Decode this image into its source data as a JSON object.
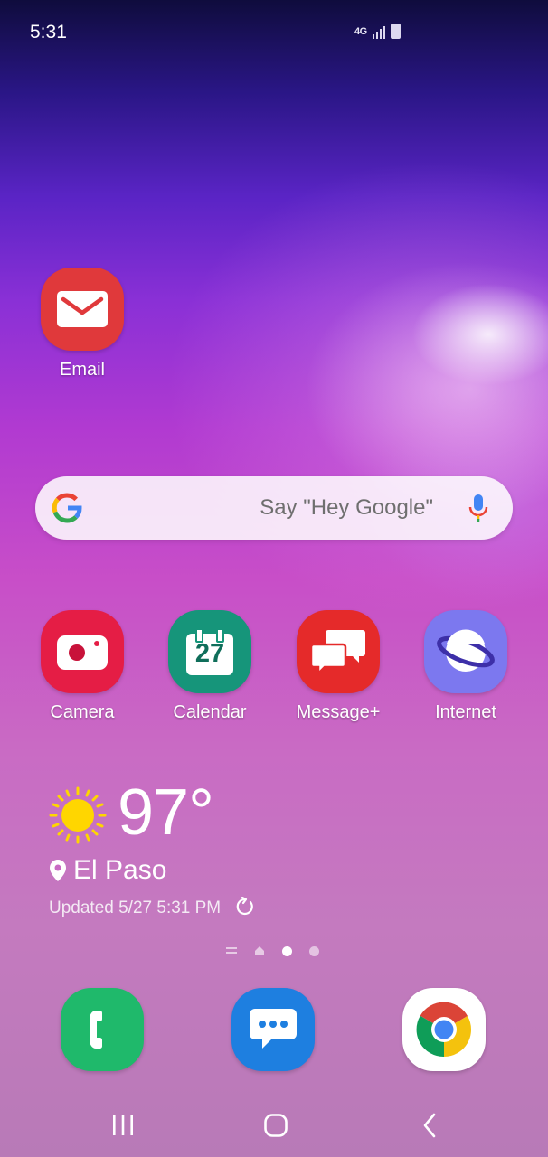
{
  "status_bar": {
    "time": "5:31",
    "network": "4G",
    "icons": [
      "network-4g-icon",
      "signal-icon",
      "battery-icon"
    ]
  },
  "home": {
    "email": {
      "label": "Email",
      "icon": "envelope-icon",
      "color": "#e0393b"
    },
    "search": {
      "placeholder": "Say \"Hey Google\"",
      "icons": [
        "google-g-icon",
        "mic-icon"
      ]
    },
    "apps": [
      {
        "label": "Camera",
        "icon": "camera-icon",
        "color": "#e51d45"
      },
      {
        "label": "Calendar",
        "icon": "calendar-icon",
        "color": "#16957a",
        "day": "27"
      },
      {
        "label": "Message+",
        "icon": "chat-bubbles-icon",
        "color": "#e52a2a"
      },
      {
        "label": "Internet",
        "icon": "planet-icon",
        "color": "#7c78ef"
      }
    ],
    "weather": {
      "temperature": "97°",
      "location": "El Paso",
      "updated": "Updated 5/27 5:31 PM",
      "icons": [
        "sun-icon",
        "location-pin-icon",
        "refresh-icon"
      ]
    },
    "page_indicator": {
      "pages": 2,
      "active_page": 1
    },
    "dock": [
      {
        "name": "Phone",
        "icon": "phone-icon",
        "color": "#1fb96b"
      },
      {
        "name": "Messages",
        "icon": "message-bubble-icon",
        "color": "#1e7fe0"
      },
      {
        "name": "Chrome",
        "icon": "chrome-icon",
        "color": "#ffffff"
      }
    ]
  },
  "nav_bar": {
    "buttons": [
      "recent-apps-icon",
      "home-icon",
      "back-icon"
    ]
  }
}
